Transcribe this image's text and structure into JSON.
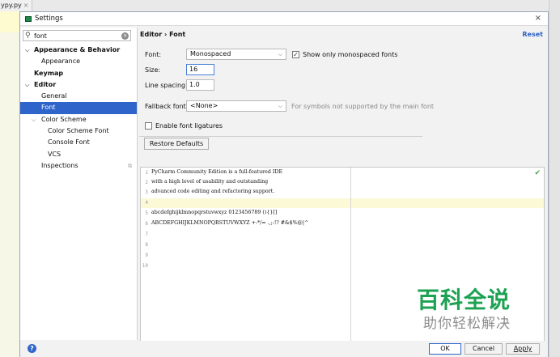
{
  "background": {
    "tab_label": "ypy.py",
    "tab_close": "×"
  },
  "dialog": {
    "title": "Settings",
    "close": "×"
  },
  "search": {
    "value": "font",
    "clear": "×"
  },
  "sidebar": {
    "items": [
      {
        "label": "Appearance & Behavior",
        "bold": true,
        "arrow": "⌵"
      },
      {
        "label": "Appearance"
      },
      {
        "label": "Keymap",
        "bold": true
      },
      {
        "label": "Editor",
        "bold": true,
        "arrow": "⌵"
      },
      {
        "label": "General"
      },
      {
        "label": "Font",
        "selected": true
      },
      {
        "label": "Color Scheme",
        "arrow": "⌵"
      },
      {
        "label": "Color Scheme Font"
      },
      {
        "label": "Console Font"
      },
      {
        "label": "VCS"
      },
      {
        "label": "Inspections"
      }
    ]
  },
  "header": {
    "breadcrumb": "Editor › Font",
    "reset": "Reset"
  },
  "form": {
    "font_label": "Font:",
    "font_value": "Monospaced",
    "mono_only_label": "Show only monospaced fonts",
    "size_label": "Size:",
    "size_value": "16",
    "spacing_label": "Line spacing:",
    "spacing_value": "1.0",
    "fallback_label": "Fallback font:",
    "fallback_value": "<None>",
    "fallback_hint": "For symbols not supported by the main font",
    "ligatures_label": "Enable font ligatures",
    "restore_label": "Restore Defaults"
  },
  "preview": {
    "lines": [
      {
        "n": "1",
        "text": "PyCharm Community Edition is a full-featured IDE"
      },
      {
        "n": "2",
        "text": "with a high level of usability and outstanding"
      },
      {
        "n": "3",
        "text": "advanced code editing and refactoring support."
      },
      {
        "n": "4",
        "text": ""
      },
      {
        "n": "5",
        "text": "abcdefghijklmnopqrstuvwxyz 0123456789 (){}[]"
      },
      {
        "n": "6",
        "text": "ABCDEFGHIJKLMNOPQRSTUVWXYZ +-*/= .,;:!? #&$%@|^"
      },
      {
        "n": "7",
        "text": ""
      },
      {
        "n": "8",
        "text": ""
      },
      {
        "n": "9",
        "text": ""
      },
      {
        "n": "10",
        "text": ""
      }
    ]
  },
  "footer": {
    "help": "?",
    "ok": "OK",
    "cancel": "Cancel",
    "apply": "Apply"
  },
  "watermark": {
    "line1": "百科全说",
    "line2": "助你轻松解决"
  },
  "colors": {
    "selection": "#2f65ca",
    "link": "#2c62c5",
    "watermark": "#1da152"
  }
}
